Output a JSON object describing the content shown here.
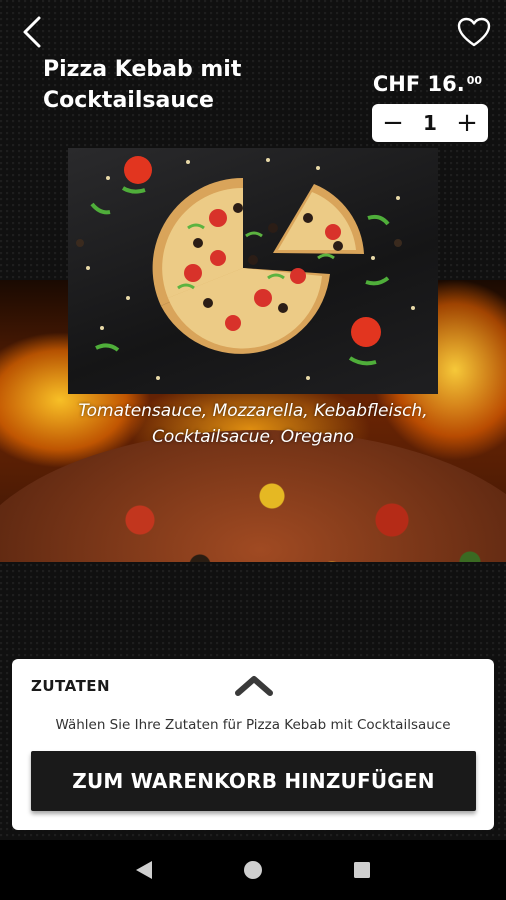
{
  "header": {
    "title": "Pizza Kebab mit Cocktailsauce",
    "price_main": "CHF 16.",
    "price_cents": "00",
    "back_icon": "chevron-left-icon",
    "favorite_icon": "heart-outline-icon"
  },
  "quantity": {
    "value": "1",
    "minus_label": "−",
    "plus_label": "+"
  },
  "product": {
    "description": "Tomatensauce, Mozzarella, Kebabfleisch, Cocktailsacue, Oregano"
  },
  "sheet": {
    "title": "ZUTATEN",
    "toggle_icon": "chevron-up-icon",
    "hint": "Wählen Sie Ihre Zutaten für Pizza Kebab mit Cocktailsauce",
    "cart_button_label": "ZUM WARENKORB HINZUFÜGEN"
  },
  "navbar": {
    "back_icon": "triangle-back-icon",
    "home_icon": "circle-home-icon",
    "recents_icon": "square-recents-icon"
  },
  "colors": {
    "background": "#101010",
    "sheet": "#ffffff",
    "button": "#1a1a1a"
  }
}
